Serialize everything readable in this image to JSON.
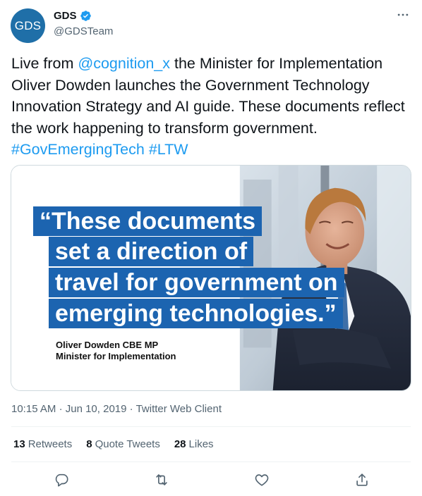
{
  "author": {
    "avatar_text": "GDS",
    "display_name": "GDS",
    "handle": "@GDSTeam",
    "verified": true
  },
  "tweet": {
    "text_parts": {
      "p1": "Live from ",
      "mention": "@cognition_x",
      "p2": " the Minister for Implementation Oliver Dowden launches the Government Technology Innovation Strategy and AI guide. These documents reflect the work happening to transform government. ",
      "hashtag1": "#GovEmergingTech",
      "space": " ",
      "hashtag2": "#LTW"
    }
  },
  "media": {
    "quote_lines": [
      "“These documents",
      "set a direction of",
      "travel for government on",
      "emerging technologies.”"
    ],
    "attribution_name": "Oliver Dowden CBE MP",
    "attribution_title": "Minister for Implementation"
  },
  "meta": {
    "time": "10:15 AM",
    "date": "Jun 10, 2019",
    "client": "Twitter Web Client",
    "separator": "·"
  },
  "stats": {
    "retweets_count": "13",
    "retweets_label": "Retweets",
    "quotes_count": "8",
    "quotes_label": "Quote Tweets",
    "likes_count": "28",
    "likes_label": "Likes"
  },
  "icons": {
    "more": "more-icon",
    "reply": "reply-icon",
    "retweet": "retweet-icon",
    "like": "like-icon",
    "share": "share-icon"
  },
  "colors": {
    "link": "#1d9bf0",
    "avatar_bg": "#1f6fa8",
    "quote_bg": "#1c64b0",
    "muted": "#536471"
  }
}
